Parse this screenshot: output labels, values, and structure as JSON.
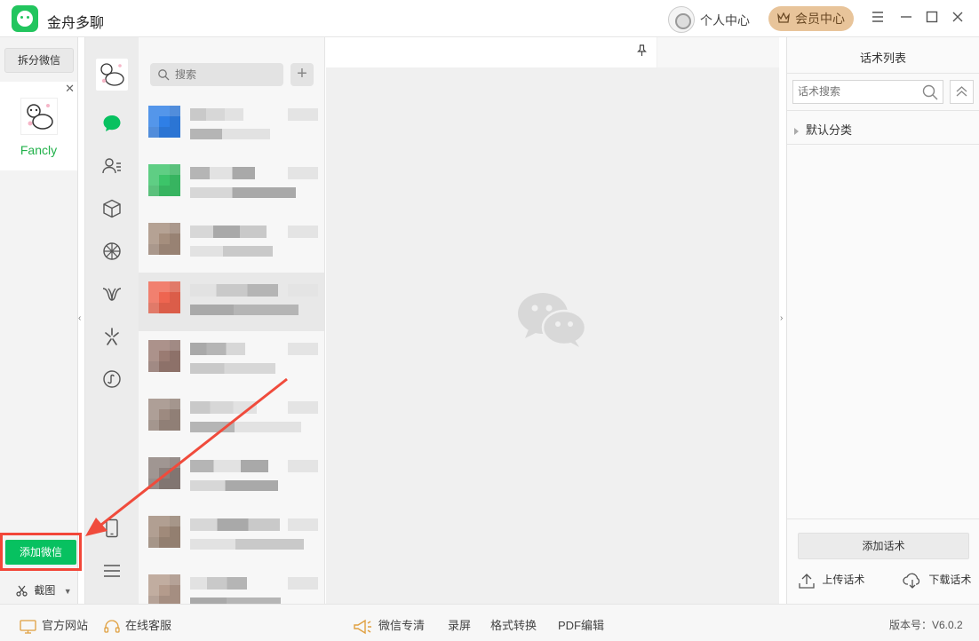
{
  "window": {
    "title": "金舟多聊",
    "personal_center": "个人中心",
    "member_center": "会员中心",
    "menu_icon": "hamburger-icon",
    "minimize_icon": "minimize-icon",
    "maximize_icon": "maximize-icon",
    "close_icon": "close-icon"
  },
  "accounts": {
    "split_label": "拆分微信",
    "items": [
      {
        "name": "Fancly"
      }
    ],
    "add_label": "添加微信",
    "screenshot_label": "截图"
  },
  "nav": {
    "icons": [
      "chat-icon",
      "contacts-icon",
      "favorites-icon",
      "moments-icon",
      "channels-icon",
      "discover-icon",
      "mini-program-icon",
      "phone-icon",
      "more-menu-icon"
    ]
  },
  "chat_list": {
    "search_placeholder": "搜索",
    "add_label": "+",
    "items": [
      {
        "color": "#2f7fe6"
      },
      {
        "color": "#3cc469"
      },
      {
        "color": "#a58e7d"
      },
      {
        "color": "#ee6550"
      },
      {
        "color": "#9a7b72"
      },
      {
        "color": "#9d8a80"
      },
      {
        "color": "#8c7f7b"
      },
      {
        "color": "#a08a7a"
      },
      {
        "color": "#b49b8c"
      }
    ]
  },
  "script_panel": {
    "title": "话术列表",
    "search_placeholder": "话术搜索",
    "category": "默认分类",
    "add_label": "添加话术",
    "upload_label": "上传话术",
    "download_label": "下载话术"
  },
  "statusbar": {
    "website": "官方网站",
    "service": "在线客服",
    "wechat_clean": "微信专清",
    "record": "录屏",
    "format": "格式转换",
    "pdf": "PDF编辑",
    "version": "版本号：V6.0.2"
  },
  "colors": {
    "accent": "#07c160",
    "highlight": "#f24638",
    "member_gold": "#e8c49a"
  }
}
